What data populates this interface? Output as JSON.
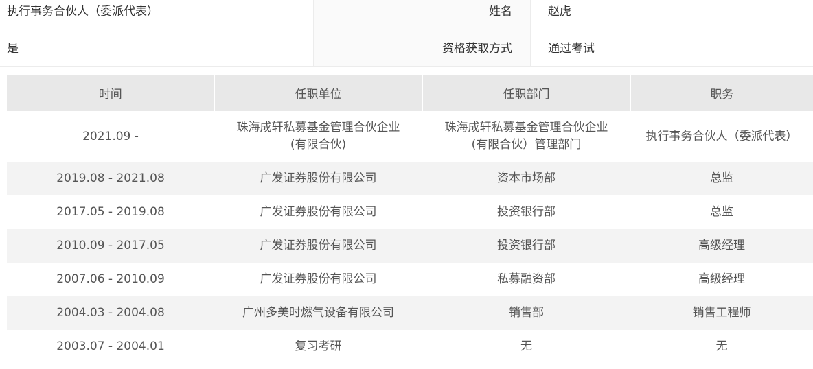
{
  "info": {
    "row1": {
      "left": "执行事务合伙人（委派代表）",
      "label": "姓名",
      "value": "赵虎"
    },
    "row2": {
      "left": "是",
      "label": "资格获取方式",
      "value": "通过考试"
    }
  },
  "table": {
    "headers": [
      "时间",
      "任职单位",
      "任职部门",
      "职务"
    ],
    "rows": [
      {
        "time": "2021.09 -",
        "unit_l1": "珠海成轩私募基金管理合伙企业",
        "unit_l2": "(有限合伙)",
        "dept_l1": "珠海成轩私募基金管理合伙企业",
        "dept_l2": "(有限合伙）管理部门",
        "title": "执行事务合伙人（委派代表）"
      },
      {
        "time": "2019.08 - 2021.08",
        "unit": "广发证券股份有限公司",
        "dept": "资本市场部",
        "title": "总监"
      },
      {
        "time": "2017.05 - 2019.08",
        "unit": "广发证券股份有限公司",
        "dept": "投资银行部",
        "title": "总监"
      },
      {
        "time": "2010.09 - 2017.05",
        "unit": "广发证券股份有限公司",
        "dept": "投资银行部",
        "title": "高级经理"
      },
      {
        "time": "2007.06 - 2010.09",
        "unit": "广发证券股份有限公司",
        "dept": "私募融资部",
        "title": "高级经理"
      },
      {
        "time": "2004.03 - 2004.08",
        "unit": "广州多美时燃气设备有限公司",
        "dept": "销售部",
        "title": "销售工程师"
      },
      {
        "time": "2003.07 - 2004.01",
        "unit": "复习考研",
        "dept": "无",
        "title": "无"
      }
    ]
  }
}
